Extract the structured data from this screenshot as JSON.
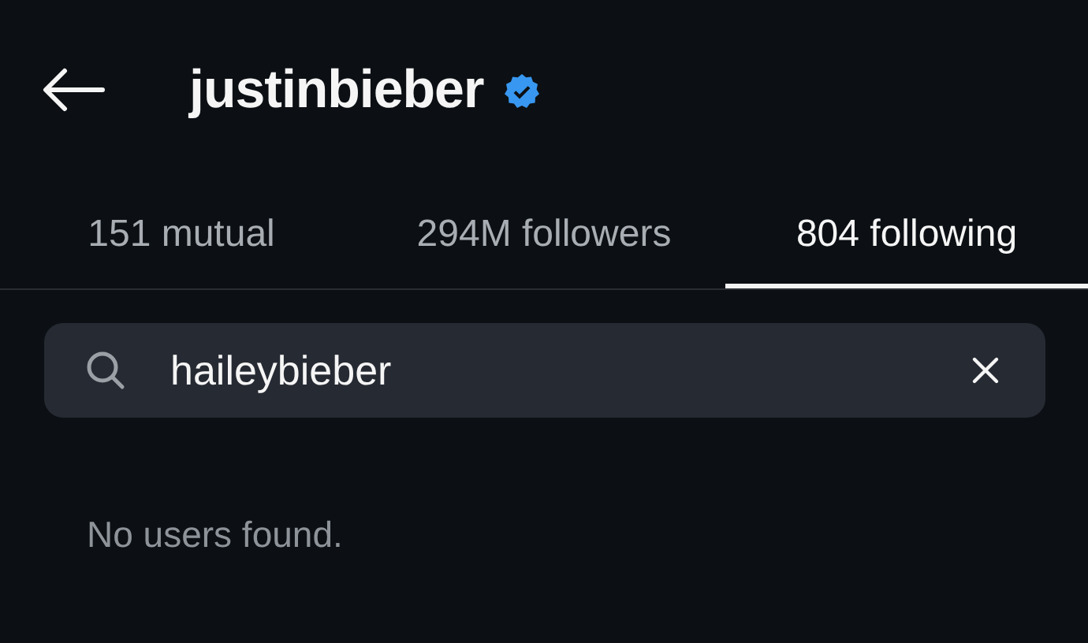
{
  "header": {
    "title": "justinbieber",
    "verified": true
  },
  "tabs": [
    {
      "label": "151 mutual",
      "selected": false
    },
    {
      "label": "294M followers",
      "selected": false
    },
    {
      "label": "804 following",
      "selected": true
    }
  ],
  "search": {
    "value": "haileybieber"
  },
  "message": "No users found."
}
